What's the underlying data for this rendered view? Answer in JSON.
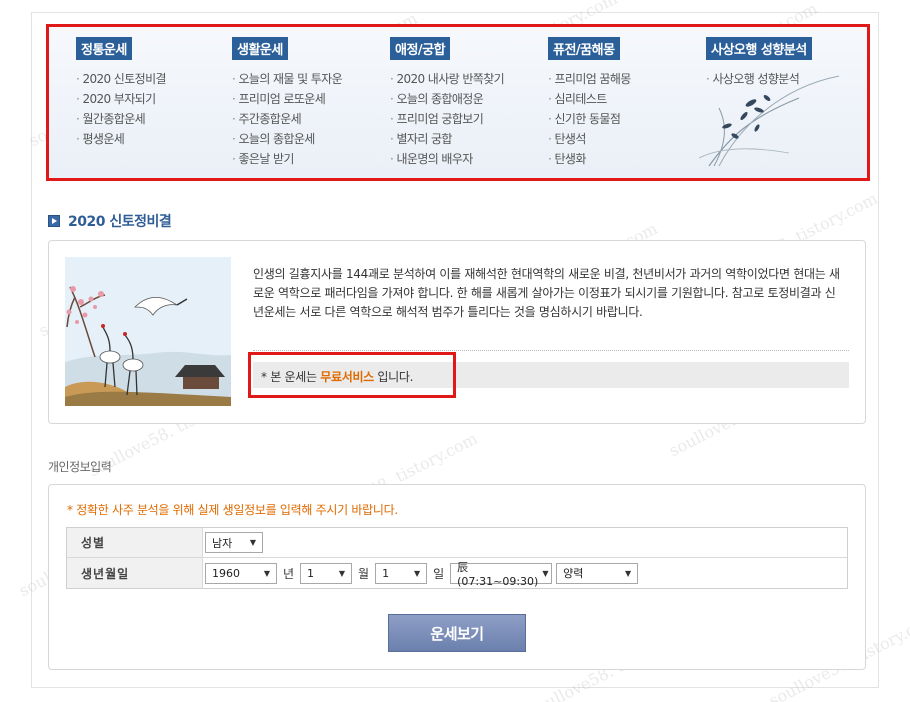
{
  "watermark": "soullove58. tistory.com",
  "menu": {
    "columns": [
      {
        "title": "정통운세",
        "items": [
          "2020 신토정비결",
          "2020 부자되기",
          "월간종합운세",
          "평생운세"
        ]
      },
      {
        "title": "생활운세",
        "items": [
          "오늘의 재물 및 투자운",
          "프리미엄 로또운세",
          "주간종합운세",
          "오늘의 종합운세",
          "좋은날 받기"
        ]
      },
      {
        "title": "애정/궁합",
        "items": [
          "2020 내사랑 반쪽찾기",
          "오늘의 종합애정운",
          "프리미엄 궁합보기",
          "별자리 궁합",
          "내운명의 배우자"
        ]
      },
      {
        "title": "퓨전/꿈해몽",
        "items": [
          "프리미엄 꿈해몽",
          "심리테스트",
          "신기한 동물점",
          "탄생석",
          "탄생화"
        ]
      },
      {
        "title": "사상오행 성향분석",
        "items": [
          "사상오행 성향분석"
        ]
      }
    ]
  },
  "section": {
    "title": "2020 신토정비결",
    "description": "인생의 길흉지사를 144괘로 분석하여 이를 재해석한 현대역학의 새로운 비결, 천년비서가 과거의 역학이었다면 현대는 새로운 역학으로 패러다임을 가져야 합니다. 한 해를 새롭게 살아가는 이정표가 되시기를 기원합니다. 참고로 토정비결과 신년운세는 서로 다른 역학으로 해석적 범주가 틀리다는 것을 명심하시기 바랍니다.",
    "notice_prefix": "* 본 운세는 ",
    "notice_free": "무료서비스",
    "notice_suffix": " 입니다."
  },
  "personal": {
    "label": "개인정보입력",
    "note": "* 정확한 사주 분석을 위해 실제 생일정보를 입력해 주시기 바랍니다.",
    "gender_label": "성별",
    "gender_value": "남자",
    "birth_label": "생년월일",
    "year_value": "1960",
    "year_suffix": "년",
    "month_value": "1",
    "month_suffix": "월",
    "day_value": "1",
    "day_suffix": "일",
    "hour_value": "辰(07:31~09:30)",
    "calendar_value": "양력",
    "submit_label": "운세보기"
  },
  "colors": {
    "highlight_border": "#e01818",
    "menu_head": "#2b5f99",
    "accent_orange": "#e06a00",
    "section_title": "#2f5d96"
  }
}
